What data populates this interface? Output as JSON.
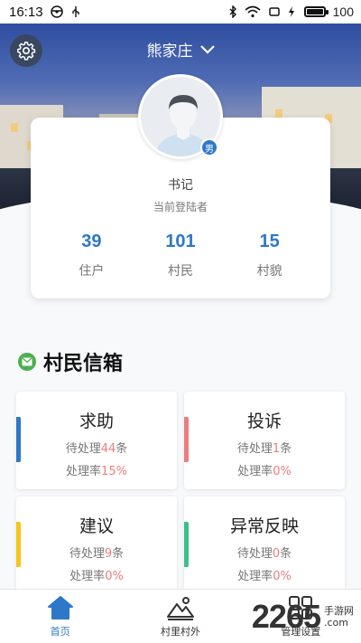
{
  "status_bar": {
    "time": "16:13",
    "battery_text": "100",
    "battery_level": 1.0
  },
  "header": {
    "village_name": "熊家庄"
  },
  "profile": {
    "gender": "男",
    "role": "书记",
    "subtitle": "当前登陆者",
    "stats": [
      {
        "value": "39",
        "label": "住户"
      },
      {
        "value": "101",
        "label": "村民"
      },
      {
        "value": "15",
        "label": "村貌"
      }
    ]
  },
  "mailbox": {
    "title": "村民信箱",
    "tiles": [
      {
        "title": "求助",
        "pending_label": "待处理",
        "pending_value": "44",
        "pending_unit": "条",
        "rate_label": "处理率",
        "rate_value": "15%",
        "bar_color": "#2d78c8"
      },
      {
        "title": "投诉",
        "pending_label": "待处理",
        "pending_value": "1",
        "pending_unit": "条",
        "rate_label": "处理率",
        "rate_value": "0%",
        "bar_color": "#ec7d7d"
      },
      {
        "title": "建议",
        "pending_label": "待处理",
        "pending_value": "9",
        "pending_unit": "条",
        "rate_label": "处理率",
        "rate_value": "0%",
        "bar_color": "#f5c518"
      },
      {
        "title": "异常反映",
        "pending_label": "待处理",
        "pending_value": "0",
        "pending_unit": "条",
        "rate_label": "处理率",
        "rate_value": "0%",
        "bar_color": "#3cbf8a"
      }
    ]
  },
  "bottom_nav": {
    "items": [
      {
        "label": "首页",
        "icon": "home-icon",
        "active": true
      },
      {
        "label": "村里村外",
        "icon": "mountain-icon",
        "active": false
      },
      {
        "label": "管理设置",
        "icon": "grid-icon",
        "active": false
      }
    ]
  },
  "watermark": {
    "big": "2265",
    "line1": "手游网",
    "line2": ".com"
  },
  "colors": {
    "accent": "#2d78c8",
    "danger": "#ec7d7d",
    "mail_green": "#4caf50"
  }
}
